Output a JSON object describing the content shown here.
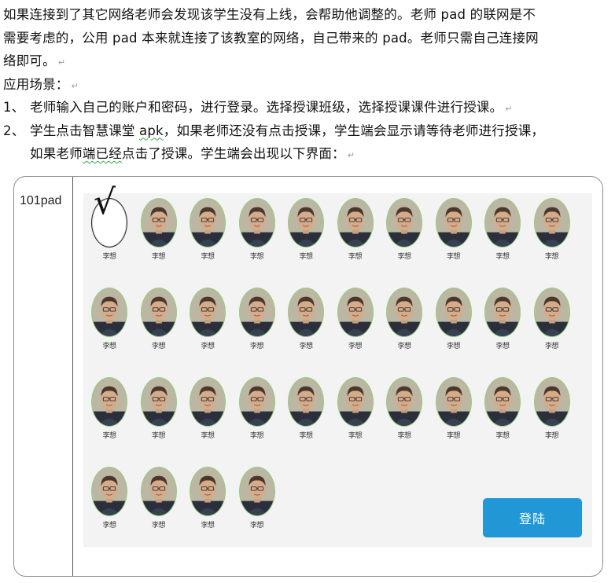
{
  "doc": {
    "para1_line1": "如果连接到了其它网络老师会发现该学生没有上线，会帮助他调整的。老师 pad 的联网是不",
    "para1_line2": "需要考虑的，公用 pad 本来就连接了该教室的网络，自己带来的 pad。老师只需自己连接网",
    "para1_line3": "络即可。",
    "scenario_heading": "应用场景：",
    "item1_number": "1、",
    "item1_text": "老师输入自己的账户和密码，进行登录。选择授课班级，选择授课课件进行授课。",
    "item2_number": "2、",
    "item2_line1_a": "学生点击智慧课堂 ",
    "item2_line1_apk": "apk",
    "item2_line1_b": "，如果老师还没有点击授课，学生端会显示请等待老师进行授课，",
    "item2_line2_a": "如果老师",
    "item2_line2_b": "端已经",
    "item2_line2_c": "点击了授课。学生端会出现以下界面：",
    "paragraph_mark": "↵"
  },
  "screen": {
    "device_name": "101pad",
    "selected_mark": "√",
    "login_label": "登陆",
    "students": [
      {
        "name": "李想",
        "selected": true
      },
      {
        "name": "李想",
        "selected": false
      },
      {
        "name": "李想",
        "selected": false
      },
      {
        "name": "李想",
        "selected": false
      },
      {
        "name": "李想",
        "selected": false
      },
      {
        "name": "李想",
        "selected": false
      },
      {
        "name": "李想",
        "selected": false
      },
      {
        "name": "李想",
        "selected": false
      },
      {
        "name": "李想",
        "selected": false
      },
      {
        "name": "李想",
        "selected": false
      },
      {
        "name": "李想",
        "selected": false
      },
      {
        "name": "李想",
        "selected": false
      },
      {
        "name": "李想",
        "selected": false
      },
      {
        "name": "李想",
        "selected": false
      },
      {
        "name": "李想",
        "selected": false
      },
      {
        "name": "李想",
        "selected": false
      },
      {
        "name": "李想",
        "selected": false
      },
      {
        "name": "李想",
        "selected": false
      },
      {
        "name": "李想",
        "selected": false
      },
      {
        "name": "李想",
        "selected": false
      },
      {
        "name": "李想",
        "selected": false
      },
      {
        "name": "李想",
        "selected": false
      },
      {
        "name": "李想",
        "selected": false
      },
      {
        "name": "李想",
        "selected": false
      },
      {
        "name": "李想",
        "selected": false
      },
      {
        "name": "李想",
        "selected": false
      },
      {
        "name": "李想",
        "selected": false
      },
      {
        "name": "李想",
        "selected": false
      },
      {
        "name": "李想",
        "selected": false
      },
      {
        "name": "李想",
        "selected": false
      },
      {
        "name": "李想",
        "selected": false
      },
      {
        "name": "李想",
        "selected": false
      },
      {
        "name": "李想",
        "selected": false
      },
      {
        "name": "李想",
        "selected": false
      }
    ]
  }
}
